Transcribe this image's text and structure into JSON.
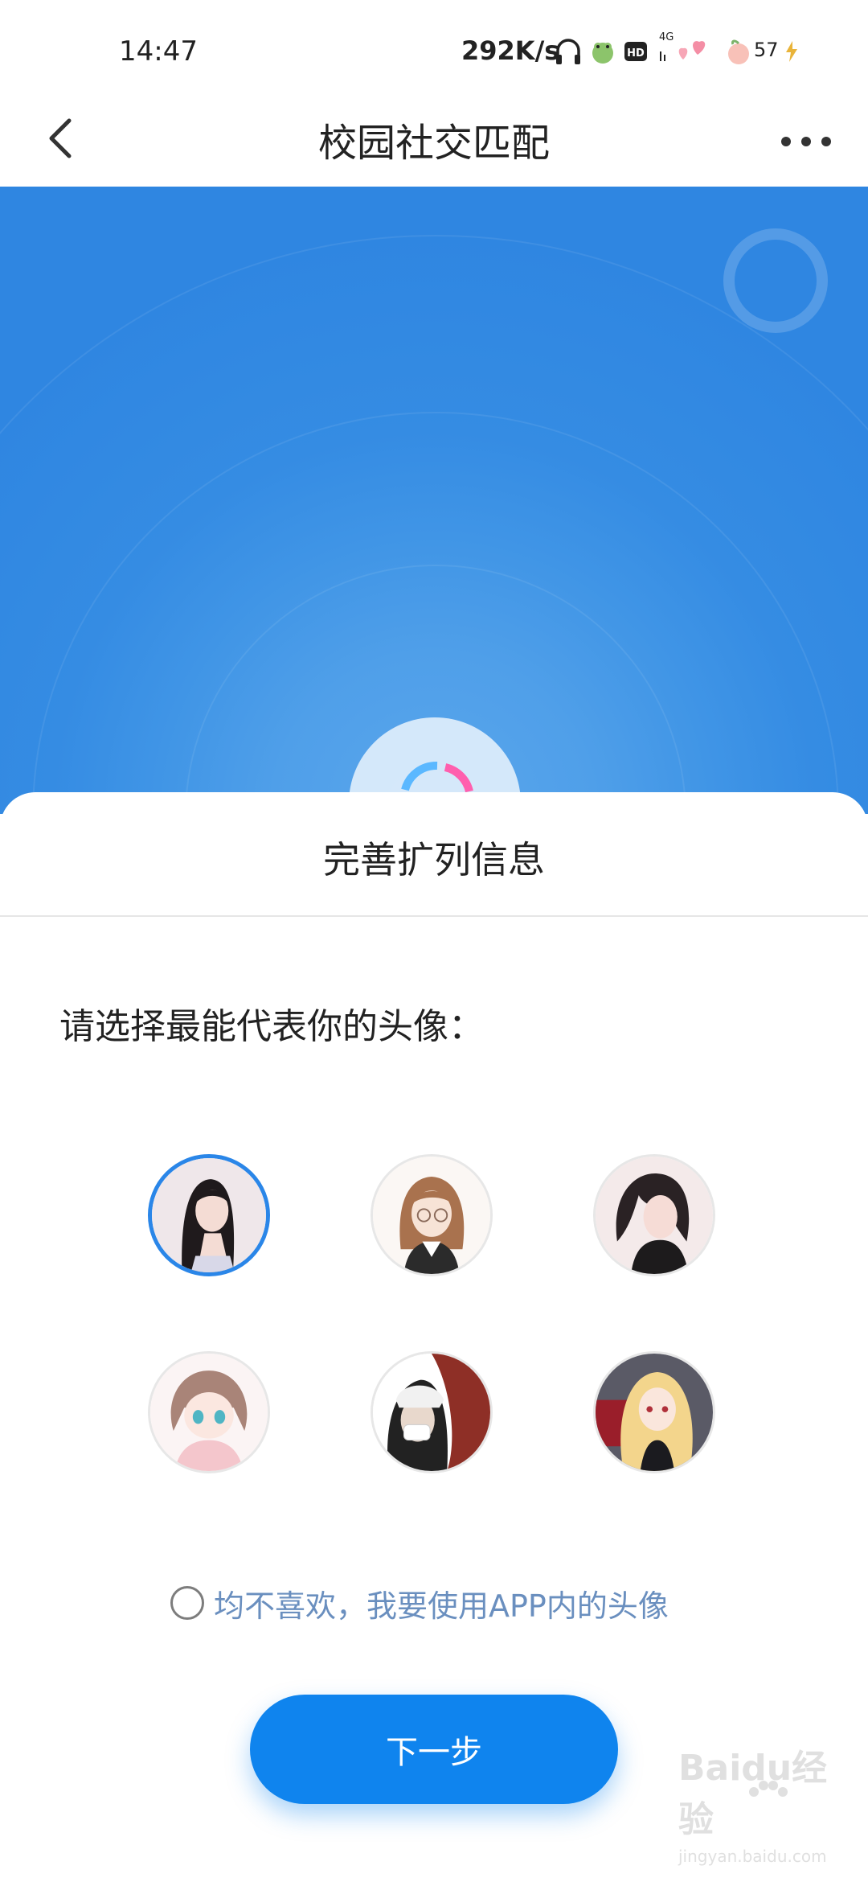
{
  "status_bar": {
    "time": "14:47",
    "network_speed": "292K/s",
    "battery": "57",
    "icons": [
      "headphones-icon",
      "frog-sticker-icon",
      "hd-icon",
      "4g-signal-icon",
      "hearts-sticker-icon",
      "peach-sticker-icon",
      "charging-icon"
    ]
  },
  "header": {
    "title": "校园社交匹配",
    "back_icon": "chevron-left-icon",
    "more_icon": "more-dots-icon"
  },
  "sheet": {
    "title": "完善扩列信息",
    "prompt": "请选择最能代表你的头像：",
    "avatars": [
      {
        "name": "avatar-1",
        "selected": true
      },
      {
        "name": "avatar-2",
        "selected": false
      },
      {
        "name": "avatar-3",
        "selected": false
      },
      {
        "name": "avatar-4",
        "selected": false
      },
      {
        "name": "avatar-5",
        "selected": false
      },
      {
        "name": "avatar-6",
        "selected": false
      }
    ],
    "none_option": "均不喜欢，我要使用APP内的头像",
    "next_button": "下一步"
  },
  "watermark": {
    "text": "Baidu经验",
    "url": "jingyan.baidu.com"
  },
  "colors": {
    "accent": "#0f84ee",
    "hero_blue": "#358ce3",
    "selected_ring": "#2a86e8",
    "option_text": "#6a8fbf"
  }
}
